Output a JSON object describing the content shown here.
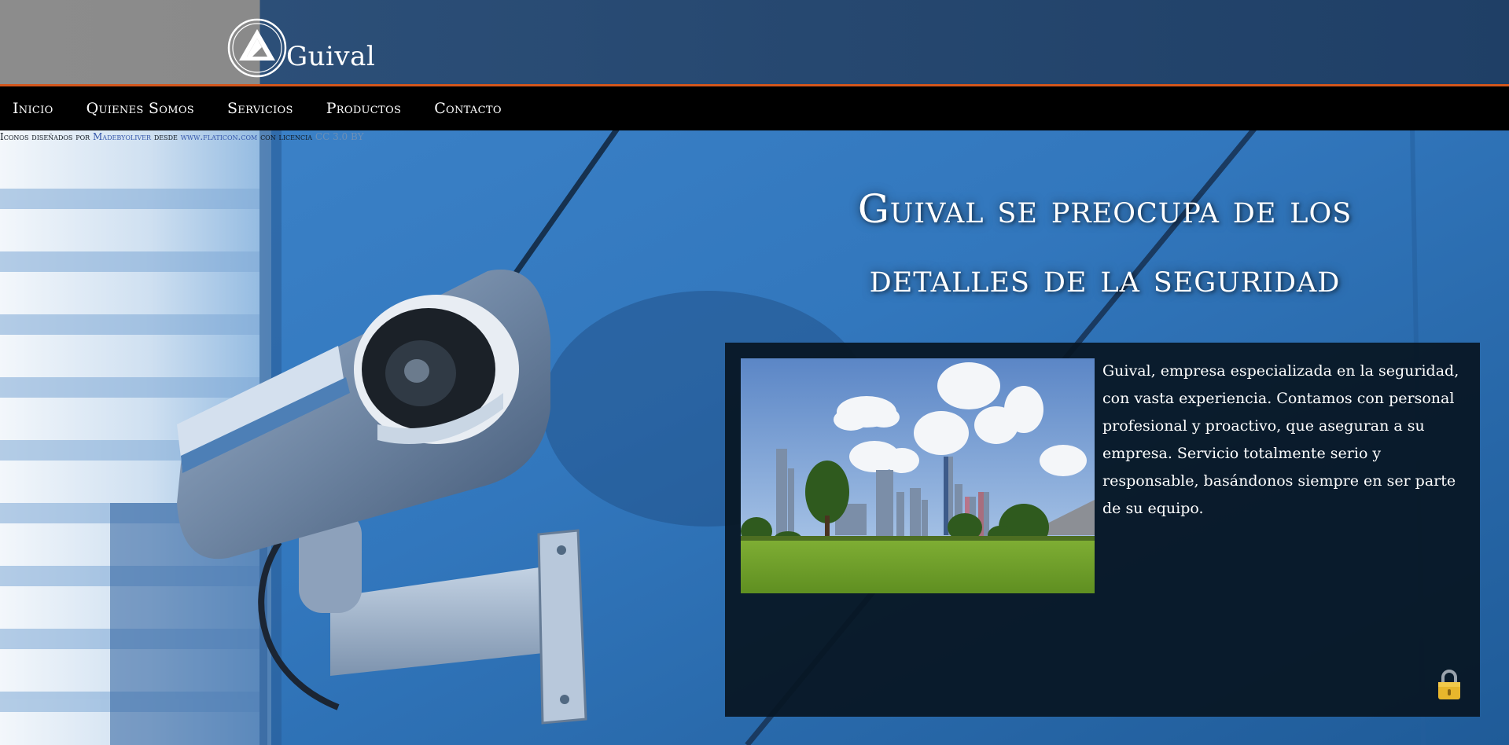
{
  "brand": {
    "name": "Guival",
    "logo_icon": "triangle-circle-logo"
  },
  "nav": {
    "items": [
      {
        "label": "Inicio"
      },
      {
        "label": "Quienes Somos"
      },
      {
        "label": "Servicios"
      },
      {
        "label": "Productos"
      },
      {
        "label": "Contacto"
      }
    ]
  },
  "credits": {
    "prefix": "Iconos diseñados por",
    "author": "Madebyoliver",
    "middle": "desde",
    "site": "www.flaticon.com",
    "license_prefix": "con licencia",
    "license": "CC 3.0 BY"
  },
  "hero": {
    "title_line1": "Guival se preocupa de los",
    "title_line2": "detalles de la seguridad"
  },
  "info": {
    "text": "Guival, empresa especializada en la seguridad, con vasta experiencia. Contamos con personal profesional y proactivo, que aseguran a su empresa. Servicio totalmente serio y responsable, basándonos siempre en ser parte de su equipo.",
    "image_icon": "city-park-image",
    "corner_icon": "padlock-icon"
  },
  "colors": {
    "nav_background": "#000000",
    "nav_accent_line": "#d2561c",
    "panel_background": "#081622",
    "hero_blue": "#2f74b8"
  }
}
